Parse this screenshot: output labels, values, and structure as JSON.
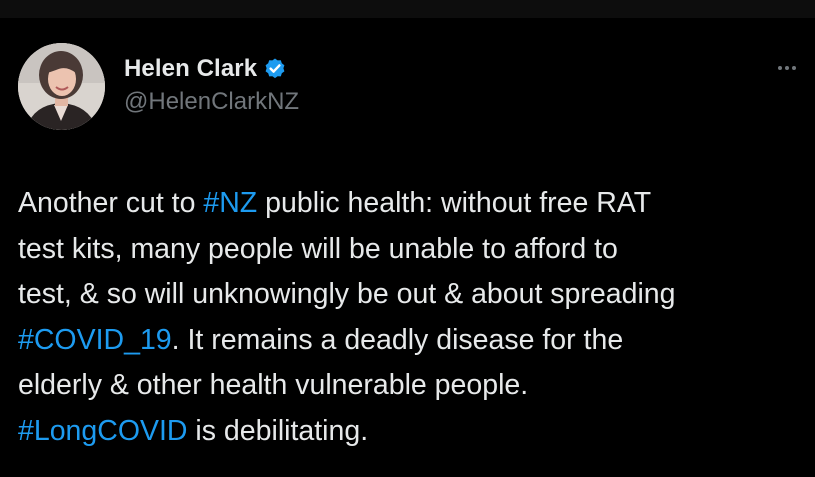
{
  "author": {
    "display_name": "Helen Clark",
    "handle": "@HelenClarkNZ",
    "verified": true
  },
  "tweet": {
    "segments": {
      "l1a": "Another cut to ",
      "l1tag": "#NZ",
      "l1b": " public health: without free RAT",
      "l2": "test kits, many people will be unable to afford to",
      "l3": "test, & so will unknowingly be out & about spreading",
      "l4tag": "#COVID_19",
      "l4b": ". It remains a deadly disease for the",
      "l5": "elderly & other health vulnerable people.",
      "l6tag": "#LongCOVID",
      "l6b": " is debilitating."
    }
  },
  "icons": {
    "verified": "verified-badge-icon",
    "more": "more-options-icon"
  },
  "colors": {
    "background": "#000000",
    "text": "#e7e9ea",
    "secondary_text": "#71767b",
    "link": "#1d9bf0",
    "verified_badge": "#1d9bf0"
  }
}
